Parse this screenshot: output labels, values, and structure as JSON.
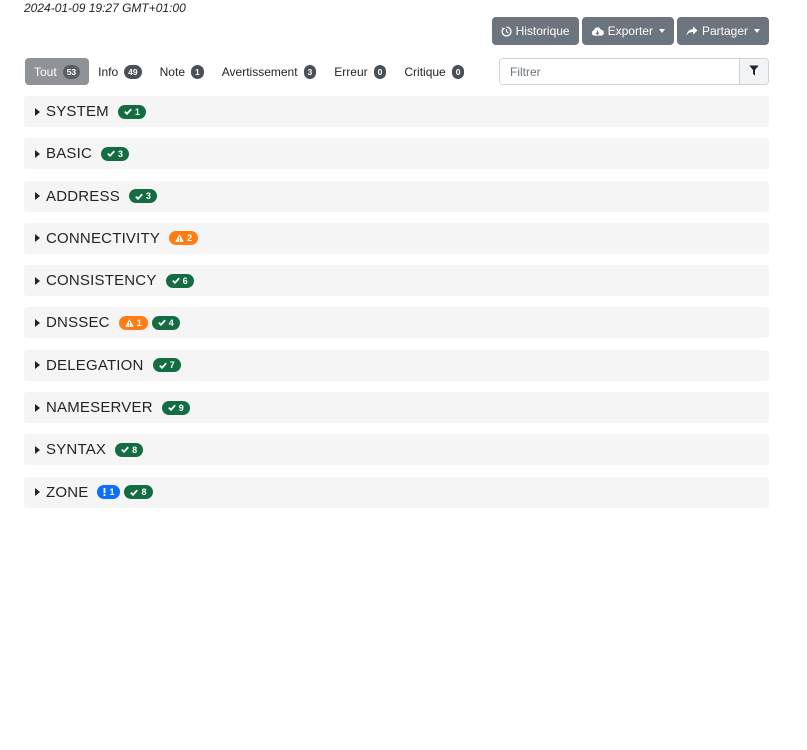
{
  "timestamp": "2024-01-09 19:27 GMT+01:00",
  "toolbar": {
    "history_label": "Historique",
    "export_label": "Exporter",
    "share_label": "Partager"
  },
  "filters": [
    {
      "label": "Tout",
      "count": "53",
      "active": true
    },
    {
      "label": "Info",
      "count": "49"
    },
    {
      "label": "Note",
      "count": "1"
    },
    {
      "label": "Avertissement",
      "count": "3"
    },
    {
      "label": "Erreur",
      "count": "0"
    },
    {
      "label": "Critique",
      "count": "0"
    }
  ],
  "filter_input": {
    "placeholder": "Filtrer",
    "value": ""
  },
  "colors": {
    "ok": "#146c43",
    "warning": "#fd7e14",
    "notice": "#0d6efd",
    "button": "#6c757d"
  },
  "modules": [
    {
      "name": "SYSTEM",
      "badges": [
        {
          "type": "ok",
          "icon": "check-icon",
          "count": "1"
        }
      ]
    },
    {
      "name": "BASIC",
      "badges": [
        {
          "type": "ok",
          "icon": "check-icon",
          "count": "3"
        }
      ]
    },
    {
      "name": "ADDRESS",
      "badges": [
        {
          "type": "ok",
          "icon": "check-icon",
          "count": "3"
        }
      ]
    },
    {
      "name": "CONNECTIVITY",
      "badges": [
        {
          "type": "warn",
          "icon": "warning-icon",
          "count": "2"
        }
      ]
    },
    {
      "name": "CONSISTENCY",
      "badges": [
        {
          "type": "ok",
          "icon": "check-icon",
          "count": "6"
        }
      ]
    },
    {
      "name": "DNSSEC",
      "badges": [
        {
          "type": "warn",
          "icon": "warning-icon",
          "count": "1"
        },
        {
          "type": "ok",
          "icon": "check-icon",
          "count": "4"
        }
      ]
    },
    {
      "name": "DELEGATION",
      "badges": [
        {
          "type": "ok",
          "icon": "check-icon",
          "count": "7"
        }
      ]
    },
    {
      "name": "NAMESERVER",
      "badges": [
        {
          "type": "ok",
          "icon": "check-icon",
          "count": "9"
        }
      ]
    },
    {
      "name": "SYNTAX",
      "badges": [
        {
          "type": "ok",
          "icon": "check-icon",
          "count": "8"
        }
      ]
    },
    {
      "name": "ZONE",
      "badges": [
        {
          "type": "notice",
          "icon": "exclamation-icon",
          "count": "1"
        },
        {
          "type": "ok",
          "icon": "check-icon",
          "count": "8"
        }
      ]
    }
  ]
}
